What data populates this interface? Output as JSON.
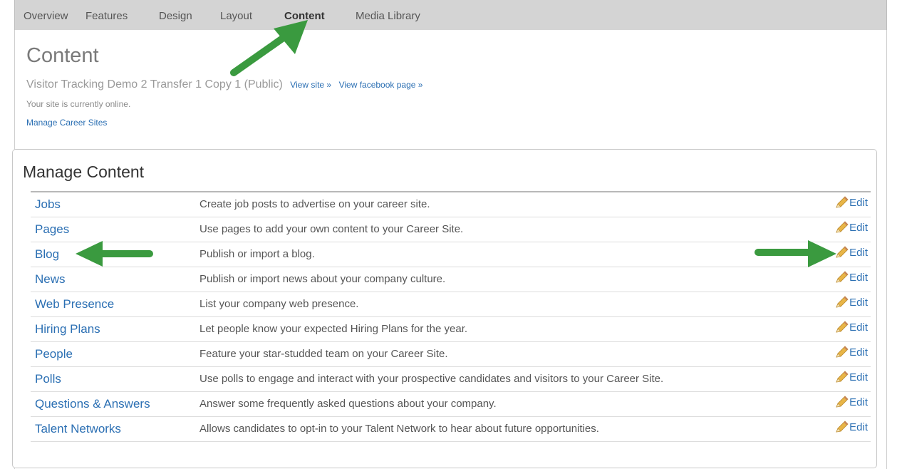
{
  "tabs": [
    {
      "label": "Overview",
      "active": false
    },
    {
      "label": "Features",
      "active": false
    },
    {
      "label": "Design",
      "active": false
    },
    {
      "label": "Layout",
      "active": false
    },
    {
      "label": "Content",
      "active": true
    },
    {
      "label": "Media Library",
      "active": false
    }
  ],
  "header": {
    "title": "Content",
    "site_name": "Visitor Tracking Demo 2 Transfer 1 Copy 1 (Public)",
    "view_site": "View site »",
    "view_facebook": "View facebook page »",
    "status": "Your site is currently online.",
    "manage_link": "Manage Career Sites"
  },
  "panel": {
    "title": "Manage Content",
    "edit_label": "Edit",
    "rows": [
      {
        "name": "Jobs",
        "description": "Create job posts to advertise on your career site."
      },
      {
        "name": "Pages",
        "description": "Use pages to add your own content to your Career Site."
      },
      {
        "name": "Blog",
        "description": "Publish or import a blog."
      },
      {
        "name": "News",
        "description": "Publish or import news about your company culture."
      },
      {
        "name": "Web Presence",
        "description": "List your company web presence."
      },
      {
        "name": "Hiring Plans",
        "description": "Let people know your expected Hiring Plans for the year."
      },
      {
        "name": "People",
        "description": "Feature your star-studded team on your Career Site."
      },
      {
        "name": "Polls",
        "description": "Use polls to engage and interact with your prospective candidates and visitors to your Career Site."
      },
      {
        "name": "Questions & Answers",
        "description": "Answer some frequently asked questions about your company."
      },
      {
        "name": "Talent Networks",
        "description": "Allows candidates to opt-in to your Talent Network to hear about future opportunities."
      }
    ]
  },
  "colors": {
    "link": "#2b6fb3",
    "arrow": "#3a9a3f",
    "tabbar": "#d4d4d4"
  }
}
